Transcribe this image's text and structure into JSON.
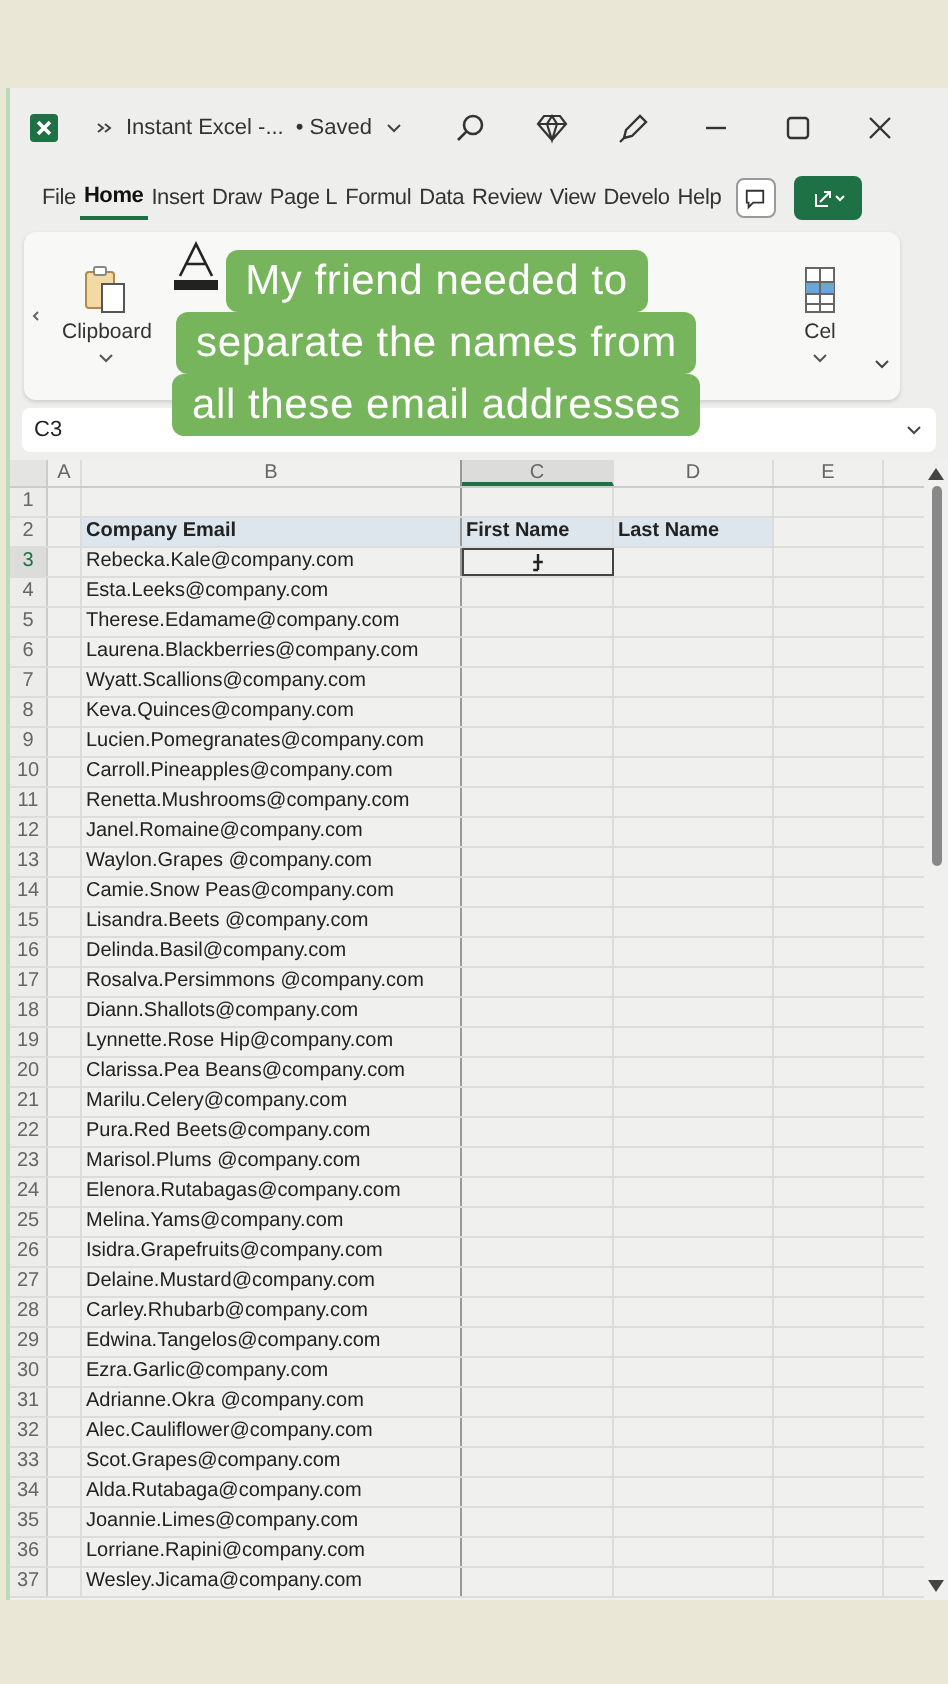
{
  "window": {
    "title": "Instant Excel -...",
    "save_status": "• Saved"
  },
  "ribbon_tabs": [
    {
      "label": "File",
      "selected": false
    },
    {
      "label": "Home",
      "selected": true
    },
    {
      "label": "Insert",
      "selected": false
    },
    {
      "label": "Draw",
      "selected": false
    },
    {
      "label": "Page L",
      "selected": false
    },
    {
      "label": "Formul",
      "selected": false
    },
    {
      "label": "Data",
      "selected": false
    },
    {
      "label": "Review",
      "selected": false
    },
    {
      "label": "View",
      "selected": false
    },
    {
      "label": "Develo",
      "selected": false
    },
    {
      "label": "Help",
      "selected": false
    }
  ],
  "ribbon_groups": [
    {
      "label": "Clipboard"
    },
    {
      "label": "Cel"
    }
  ],
  "name_box": "C3",
  "columns": [
    "A",
    "B",
    "C",
    "D",
    "E"
  ],
  "first_row": {
    "number": "1"
  },
  "header_row": {
    "number": "2",
    "cells": [
      "Company Email",
      "First Name",
      "Last Name"
    ]
  },
  "caption": {
    "lines": [
      "My friend needed to",
      "separate the names from",
      "all these email addresses"
    ]
  },
  "rows": [
    {
      "number": "3",
      "email": "Rebecka.Kale@company.com",
      "selected": true
    },
    {
      "number": "4",
      "email": "Esta.Leeks@company.com",
      "selected": false
    },
    {
      "number": "5",
      "email": "Therese.Edamame@company.com",
      "selected": false
    },
    {
      "number": "6",
      "email": "Laurena.Blackberries@company.com",
      "selected": false
    },
    {
      "number": "7",
      "email": "Wyatt.Scallions@company.com",
      "selected": false
    },
    {
      "number": "8",
      "email": "Keva.Quinces@company.com",
      "selected": false
    },
    {
      "number": "9",
      "email": "Lucien.Pomegranates@company.com",
      "selected": false
    },
    {
      "number": "10",
      "email": "Carroll.Pineapples@company.com",
      "selected": false
    },
    {
      "number": "11",
      "email": "Renetta.Mushrooms@company.com",
      "selected": false
    },
    {
      "number": "12",
      "email": "Janel.Romaine@company.com",
      "selected": false
    },
    {
      "number": "13",
      "email": "Waylon.Grapes @company.com",
      "selected": false
    },
    {
      "number": "14",
      "email": "Camie.Snow Peas@company.com",
      "selected": false
    },
    {
      "number": "15",
      "email": "Lisandra.Beets @company.com",
      "selected": false
    },
    {
      "number": "16",
      "email": "Delinda.Basil@company.com",
      "selected": false
    },
    {
      "number": "17",
      "email": "Rosalva.Persimmons @company.com",
      "selected": false
    },
    {
      "number": "18",
      "email": "Diann.Shallots@company.com",
      "selected": false
    },
    {
      "number": "19",
      "email": "Lynnette.Rose Hip@company.com",
      "selected": false
    },
    {
      "number": "20",
      "email": "Clarissa.Pea Beans@company.com",
      "selected": false
    },
    {
      "number": "21",
      "email": "Marilu.Celery@company.com",
      "selected": false
    },
    {
      "number": "22",
      "email": "Pura.Red Beets@company.com",
      "selected": false
    },
    {
      "number": "23",
      "email": "Marisol.Plums @company.com",
      "selected": false
    },
    {
      "number": "24",
      "email": "Elenora.Rutabagas@company.com",
      "selected": false
    },
    {
      "number": "25",
      "email": "Melina.Yams@company.com",
      "selected": false
    },
    {
      "number": "26",
      "email": "Isidra.Grapefruits@company.com",
      "selected": false
    },
    {
      "number": "27",
      "email": "Delaine.Mustard@company.com",
      "selected": false
    },
    {
      "number": "28",
      "email": "Carley.Rhubarb@company.com",
      "selected": false
    },
    {
      "number": "29",
      "email": "Edwina.Tangelos@company.com",
      "selected": false
    },
    {
      "number": "30",
      "email": "Ezra.Garlic@company.com",
      "selected": false
    },
    {
      "number": "31",
      "email": "Adrianne.Okra @company.com",
      "selected": false
    },
    {
      "number": "32",
      "email": "Alec.Cauliflower@company.com",
      "selected": false
    },
    {
      "number": "33",
      "email": "Scot.Grapes@company.com",
      "selected": false
    },
    {
      "number": "34",
      "email": "Alda.Rutabaga@company.com",
      "selected": false
    },
    {
      "number": "35",
      "email": "Joannie.Limes@company.com",
      "selected": false
    },
    {
      "number": "36",
      "email": "Lorriane.Rapini@company.com",
      "selected": false
    },
    {
      "number": "37",
      "email": "Wesley.Jicama@company.com",
      "selected": false
    }
  ]
}
